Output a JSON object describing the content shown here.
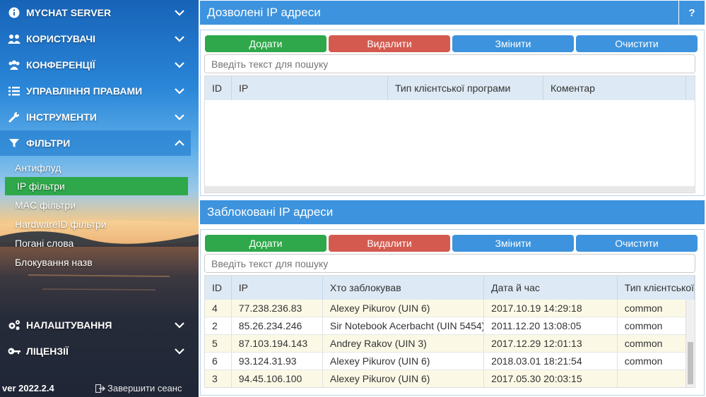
{
  "sidebar": {
    "items": [
      {
        "label": "MYCHAT SERVER",
        "icon": "info-icon"
      },
      {
        "label": "КОРИСТУВАЧІ",
        "icon": "users-icon"
      },
      {
        "label": "КОНФЕРЕНЦІЇ",
        "icon": "group-icon"
      },
      {
        "label": "УПРАВЛІННЯ ПРАВАМИ",
        "icon": "list-icon"
      },
      {
        "label": "ІНСТРУМЕНТИ",
        "icon": "wrench-icon"
      },
      {
        "label": "ФІЛЬТРИ",
        "icon": "filter-icon"
      }
    ],
    "sub_items": [
      "Антифлуд",
      "IP фільтри",
      "MAC фільтри",
      "HardwareID фільтри",
      "Погані слова",
      "Блокування назв"
    ],
    "bottom_items": [
      {
        "label": "НАЛАШТУВАННЯ",
        "icon": "cogs-icon"
      },
      {
        "label": "ЛІЦЕНЗІЇ",
        "icon": "key-icon"
      }
    ],
    "version": "ver 2022.2.4",
    "logout": "Завершити сеанс"
  },
  "allowed": {
    "title": "Дозволені IP адреси",
    "help": "?",
    "buttons": {
      "add": "Додати",
      "delete": "Видалити",
      "edit": "Змінити",
      "clear": "Очистити"
    },
    "search_placeholder": "Введіть текст для пошуку",
    "columns": [
      "ID",
      "IP",
      "Тип клієнтської програми",
      "Коментар"
    ]
  },
  "blocked": {
    "title": "Заблоковані IP адреси",
    "buttons": {
      "add": "Додати",
      "delete": "Видалити",
      "edit": "Змінити",
      "clear": "Очистити"
    },
    "search_placeholder": "Введіть текст для пошуку",
    "columns": [
      "ID",
      "IP",
      "Хто заблокував",
      "Дата й час",
      "Тип клієнтської"
    ],
    "rows": [
      [
        "4",
        "77.238.236.83",
        "Alexey Pikurov (UIN 6)",
        "2017.10.19 14:29:18",
        "common"
      ],
      [
        "2",
        "85.26.234.246",
        "Sir Notebook Acerbacht (UIN 5454)",
        "2011.12.20 13:08:05",
        "common"
      ],
      [
        "5",
        "87.103.194.143",
        "Andrey Rakov (UIN 3)",
        "2017.12.29 12:01:13",
        "common"
      ],
      [
        "6",
        "93.124.31.93",
        "Alexey Pikurov (UIN 6)",
        "2018.03.01 18:21:54",
        "common"
      ],
      [
        "3",
        "94.45.106.100",
        "Alexey Pikurov (UIN 6)",
        "2017.05.30 20:03:15",
        ""
      ]
    ]
  },
  "colors": {
    "accent": "#3d93dd",
    "add": "#2ea84a",
    "delete": "#d45a4f",
    "row_alt": "#fbf9e6"
  }
}
